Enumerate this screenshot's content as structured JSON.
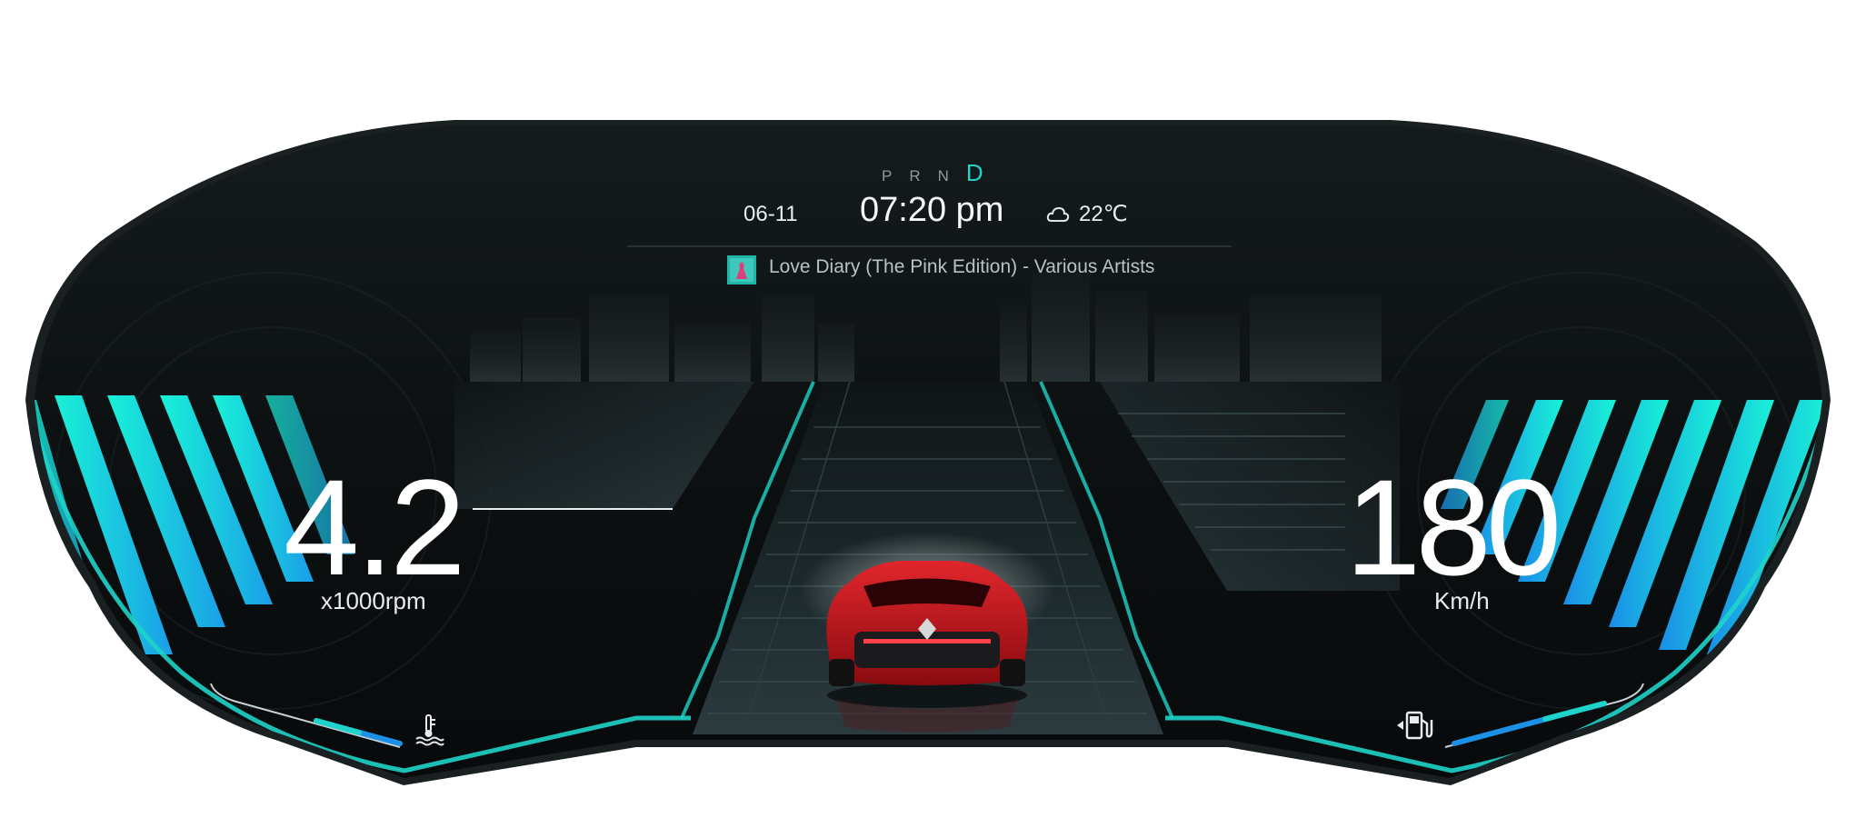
{
  "header": {
    "gears": [
      "P",
      "R",
      "N"
    ],
    "active_gear": "D",
    "date": "06-11",
    "time": "07:20 pm",
    "temperature": "22℃",
    "weather_icon": "cloud-icon"
  },
  "media": {
    "now_playing": "Love Diary (The Pink Edition) - Various Artists",
    "album_art_icon": "album-art"
  },
  "tachometer": {
    "value": "4.2",
    "unit": "x1000rpm",
    "coolant_icon": "coolant-temperature-icon",
    "coolant_level": 0.6
  },
  "speedometer": {
    "value": "180",
    "unit": "Km/h",
    "fuel_icon": "fuel-pump-icon",
    "fuel_level": 0.8
  },
  "colors": {
    "accent": "#1fd3c9",
    "accent_blue": "#1c8fe6",
    "panel": "#0d1112",
    "car": "#c8141c"
  }
}
